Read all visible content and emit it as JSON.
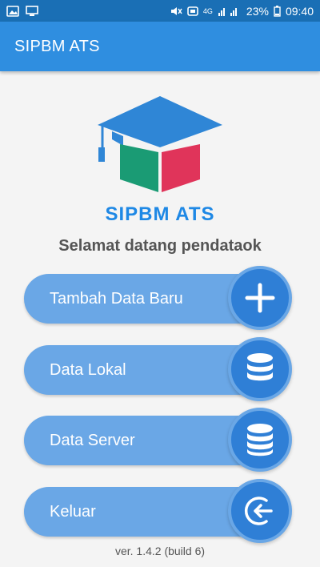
{
  "status_bar": {
    "battery_percent": "23%",
    "time": "09:40",
    "network": "4G",
    "icons": [
      "image-icon",
      "monitor-icon",
      "mute-icon",
      "data-saver-icon",
      "signal-icon",
      "battery-icon"
    ]
  },
  "app_bar": {
    "title": "SIPBM ATS"
  },
  "logo": {
    "text": "SIPBM ATS",
    "colors": {
      "cap": "#2f86d6",
      "green": "#1a9b74",
      "red": "#e0345a",
      "text": "#1e88e5"
    }
  },
  "welcome": "Selamat datang pendataok",
  "menu": [
    {
      "label": "Tambah Data Baru",
      "icon": "plus-icon"
    },
    {
      "label": "Data Lokal",
      "icon": "database-icon"
    },
    {
      "label": "Data Server",
      "icon": "database-server-icon"
    },
    {
      "label": "Keluar",
      "icon": "logout-icon"
    }
  ],
  "version": "ver. 1.4.2 (build 6)",
  "colors": {
    "primary": "#2f8ee0",
    "status_bar": "#1a6fb5",
    "pill": "#6aa7e6",
    "circle": "#2f7fd6"
  }
}
